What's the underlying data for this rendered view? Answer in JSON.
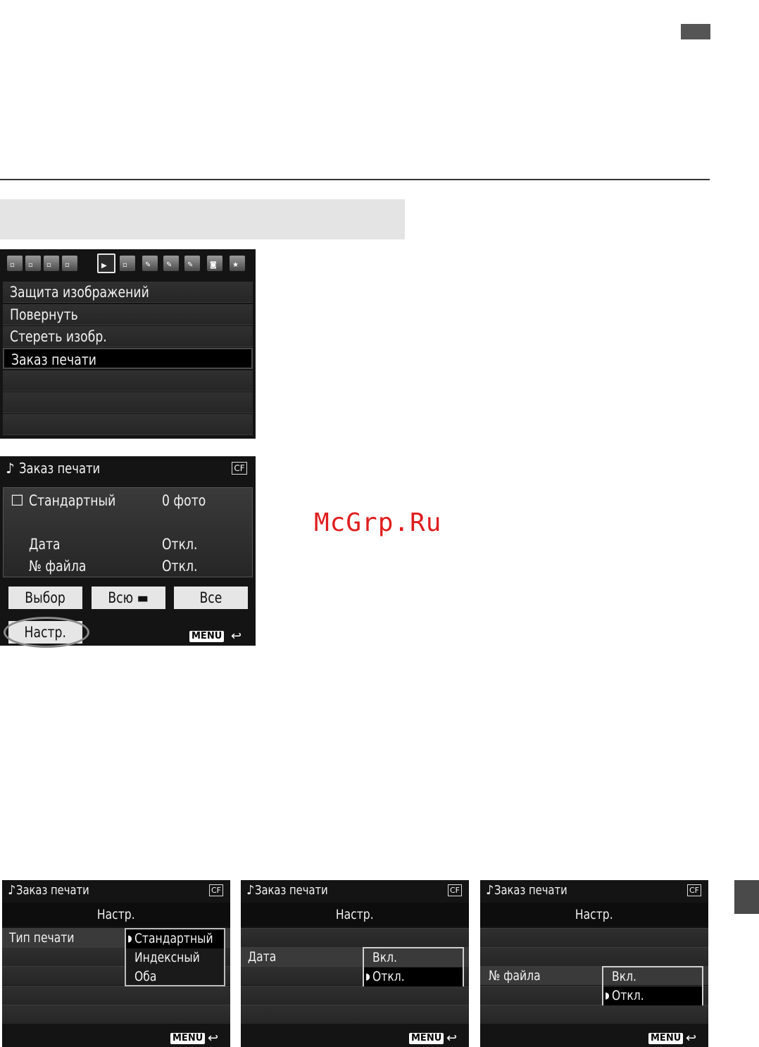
{
  "watermark": "McGrp.Ru",
  "screen_menu": {
    "items": [
      "Защита изображений",
      "Повернуть",
      "Стереть изобр.",
      "Заказ печати"
    ]
  },
  "screen_order": {
    "title": "Заказ печати",
    "card_badge": "CF",
    "print_type": "Стандартный",
    "count": "0 фото",
    "date_label": "Дата",
    "date_value": "Откл.",
    "file_label": "№ файла",
    "file_value": "Откл.",
    "btn_select": "Выбор",
    "btn_all_folder": "Всю",
    "btn_all": "Все",
    "btn_setup": "Настр.",
    "menu_badge": "MENU"
  },
  "screen_setup_type": {
    "title": "Заказ печати",
    "card_badge": "CF",
    "subtitle": "Настр.",
    "row_label": "Тип печати",
    "options": [
      "Стандартный",
      "Индексный",
      "Оба"
    ],
    "menu_badge": "MENU"
  },
  "screen_setup_date": {
    "title": "Заказ печати",
    "card_badge": "CF",
    "subtitle": "Настр.",
    "row_label": "Дата",
    "options": [
      "Вкл.",
      "Откл."
    ],
    "menu_badge": "MENU"
  },
  "screen_setup_file": {
    "title": "Заказ печати",
    "card_badge": "CF",
    "subtitle": "Настр.",
    "row_label": "№ файла",
    "options": [
      "Вкл.",
      "Откл."
    ],
    "menu_badge": "MENU"
  }
}
